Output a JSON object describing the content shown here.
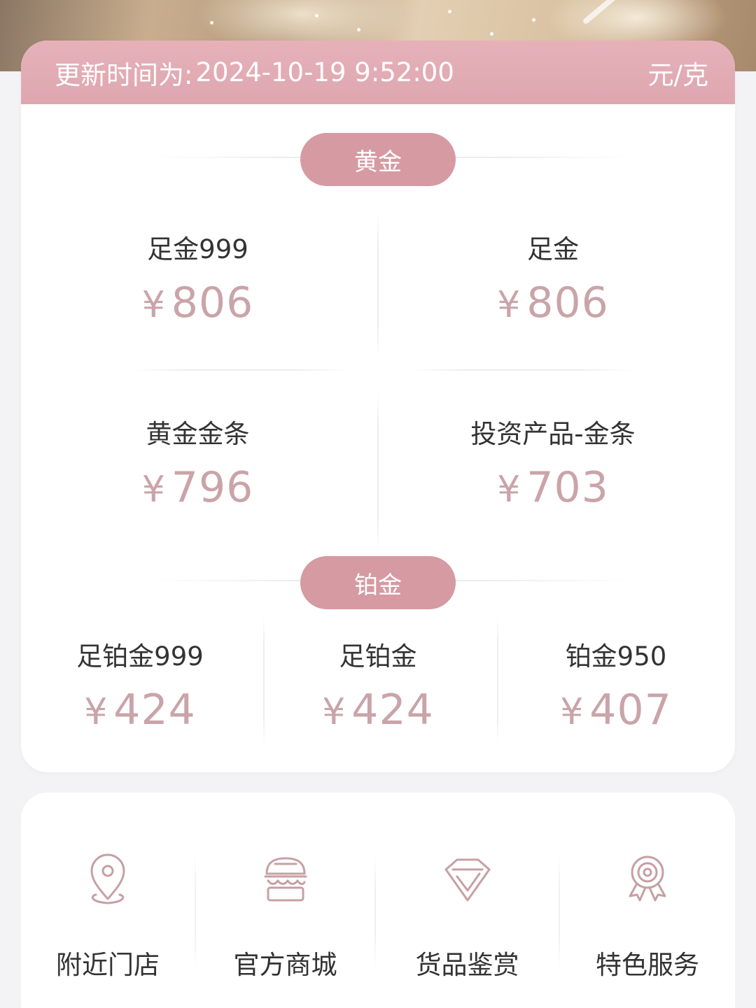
{
  "header": {
    "update_prefix": "更新时间为:",
    "update_time": "2024-10-19 9:52:00",
    "unit": "元/克"
  },
  "gold": {
    "section_label": "黄金",
    "items": [
      {
        "label": "足金999",
        "currency": "¥",
        "price": "806"
      },
      {
        "label": "足金",
        "currency": "¥",
        "price": "806"
      },
      {
        "label": "黄金金条",
        "currency": "¥",
        "price": "796"
      },
      {
        "label": "投资产品-金条",
        "currency": "¥",
        "price": "703"
      }
    ]
  },
  "platinum": {
    "section_label": "铂金",
    "items": [
      {
        "label": "足铂金999",
        "currency": "¥",
        "price": "424"
      },
      {
        "label": "足铂金",
        "currency": "¥",
        "price": "424"
      },
      {
        "label": "铂金950",
        "currency": "¥",
        "price": "407"
      }
    ]
  },
  "services": [
    {
      "label": "附近门店",
      "icon": "location-pin-icon"
    },
    {
      "label": "官方商城",
      "icon": "store-icon"
    },
    {
      "label": "货品鉴赏",
      "icon": "diamond-icon"
    },
    {
      "label": "特色服务",
      "icon": "award-badge-icon"
    }
  ],
  "colors": {
    "accent_pink": "#d59aa2",
    "header_pink": "#e3adb5",
    "price_text": "#c9a4a8",
    "icon_stroke": "#c6a0a4"
  }
}
